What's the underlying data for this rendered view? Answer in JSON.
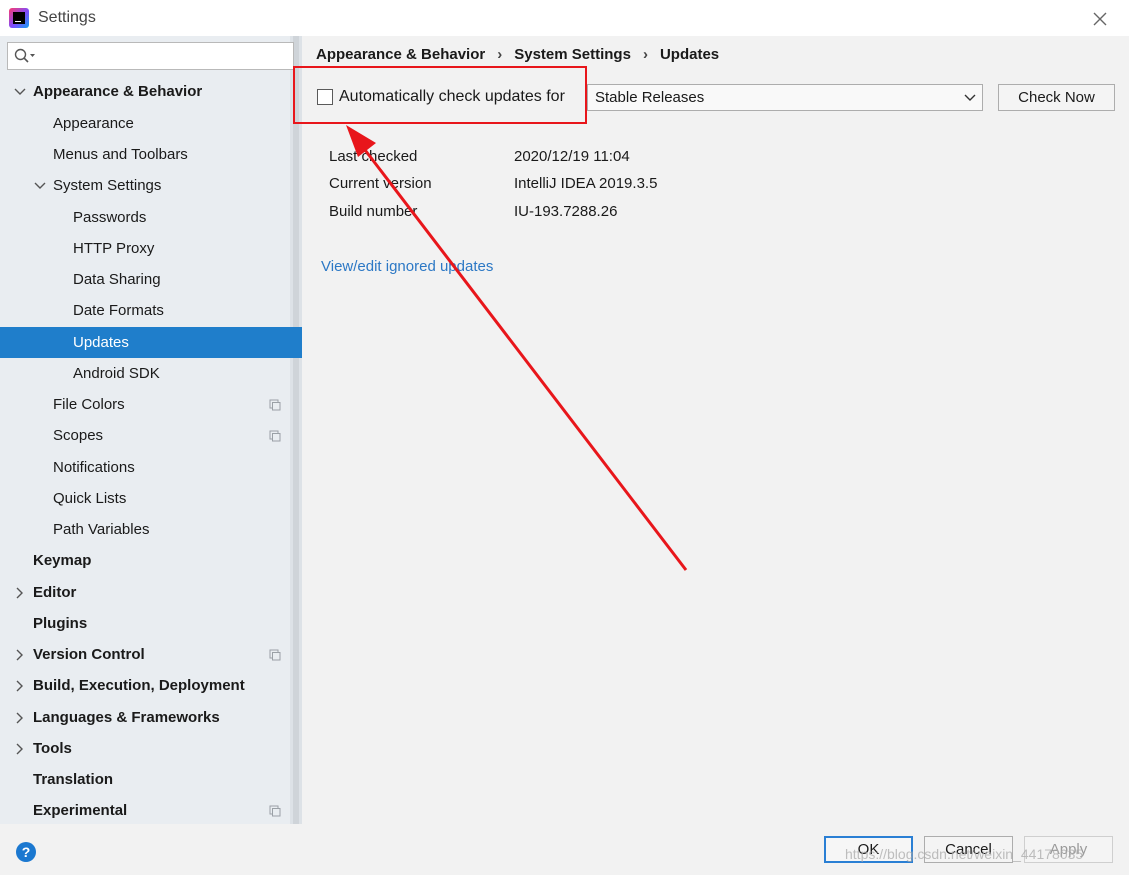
{
  "window": {
    "title": "Settings"
  },
  "search": {
    "placeholder": ""
  },
  "tree": [
    {
      "label": "Appearance & Behavior",
      "bold": true,
      "expanded": true
    },
    {
      "label": "Appearance"
    },
    {
      "label": "Menus and Toolbars"
    },
    {
      "label": "System Settings",
      "expanded": true
    },
    {
      "label": "Passwords"
    },
    {
      "label": "HTTP Proxy"
    },
    {
      "label": "Data Sharing"
    },
    {
      "label": "Date Formats"
    },
    {
      "label": "Updates",
      "selected": true
    },
    {
      "label": "Android SDK"
    },
    {
      "label": "File Colors",
      "project_icon": true
    },
    {
      "label": "Scopes",
      "project_icon": true
    },
    {
      "label": "Notifications"
    },
    {
      "label": "Quick Lists"
    },
    {
      "label": "Path Variables"
    },
    {
      "label": "Keymap",
      "bold": true
    },
    {
      "label": "Editor",
      "bold": true,
      "expanded": false
    },
    {
      "label": "Plugins",
      "bold": true
    },
    {
      "label": "Version Control",
      "bold": true,
      "expanded": false,
      "project_icon": true
    },
    {
      "label": "Build, Execution, Deployment",
      "bold": true,
      "expanded": false
    },
    {
      "label": "Languages & Frameworks",
      "bold": true,
      "expanded": false
    },
    {
      "label": "Tools",
      "bold": true,
      "expanded": false
    },
    {
      "label": "Translation",
      "bold": true
    },
    {
      "label": "Experimental",
      "bold": true,
      "project_icon": true
    }
  ],
  "breadcrumb": [
    "Appearance & Behavior",
    "System Settings",
    "Updates"
  ],
  "breadcrumb_separator": "›",
  "updates": {
    "auto_check_label": "Automatically check updates for",
    "auto_check_checked": false,
    "channel": "Stable Releases",
    "check_now_label": "Check Now",
    "info": [
      {
        "label": "Last checked",
        "value": "2020/12/19 11:04"
      },
      {
        "label": "Current version",
        "value": "IntelliJ IDEA 2019.3.5"
      },
      {
        "label": "Build number",
        "value": "IU-193.7288.26"
      }
    ],
    "ignored_link": "View/edit ignored updates"
  },
  "footer": {
    "ok": "OK",
    "cancel": "Cancel",
    "apply": "Apply",
    "help": "?"
  },
  "watermark": "https://blog.csdn.net/weixin_44178035",
  "colors": {
    "selection": "#1f7ecb",
    "link": "#2c78c5",
    "annotation": "#e8161b"
  }
}
